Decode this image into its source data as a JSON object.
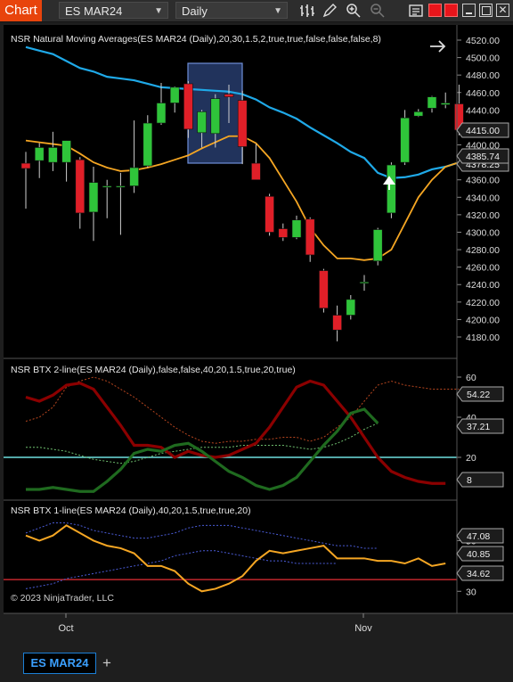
{
  "toolbar": {
    "chart_button": "Chart",
    "instrument": "ES MAR24",
    "interval": "Daily"
  },
  "panels": {
    "price": {
      "title": "NSR Natural Moving Averages(ES MAR24 (Daily),20,30,1.5,2,true,true,false,false,false,8)",
      "ticks": [
        "4520.00",
        "4500.00",
        "4480.00",
        "4460.00",
        "4440.00",
        "4420.00",
        "4400.00",
        "4380.00",
        "4360.00",
        "4340.00",
        "4320.00",
        "4300.00",
        "4280.00",
        "4260.00",
        "4240.00",
        "4220.00",
        "4200.00",
        "4180.00"
      ],
      "badge_last": "4415.00",
      "badge_ma": "4385.74",
      "badge_ma_hidden": "4378.25"
    },
    "btx2": {
      "title": "NSR BTX 2-line(ES MAR24 (Daily),false,false,40,20,1.5,true,20,true)",
      "ticks": [
        "60",
        "40",
        "20"
      ],
      "badge_a": "54.22",
      "badge_b": "37.21",
      "badge_c": "8"
    },
    "btx1": {
      "title": "NSR BTX 1-line(ES MAR24 (Daily),40,20,1.5,true,true,20)",
      "ticks": [
        "50",
        "30"
      ],
      "badge_a": "47.08",
      "badge_b": "40.85",
      "badge_c": "34.62"
    }
  },
  "copyright": "© 2023 NinjaTrader, LLC",
  "x_axis": {
    "labels": [
      "Oct",
      "Nov"
    ]
  },
  "tabs": [
    {
      "label": "ES MAR24"
    }
  ],
  "colors": {
    "bull": "#2fc43a",
    "bear": "#e01f28",
    "fast_ma": "#f5a623",
    "slow_ma": "#1fa9e8",
    "btx_red": "#8b0000",
    "btx_green": "#1f6a1f",
    "cyan_level": "#6fe0e0",
    "btx1_line": "#f5a623",
    "btx1_level": "#c1272d"
  },
  "chart_data": [
    {
      "type": "candlestick",
      "title": "NSR Natural Moving Averages(ES MAR24 (Daily),20,30,1.5,2,true,true,false,false,false,8)",
      "ylim": [
        4170,
        4530
      ],
      "xticks": [
        "Oct",
        "Nov"
      ],
      "candles": [
        {
          "o": 4379,
          "h": 4392,
          "l": 4327,
          "c": 4373
        },
        {
          "o": 4382,
          "h": 4402,
          "l": 4362,
          "c": 4397
        },
        {
          "o": 4380,
          "h": 4415,
          "l": 4370,
          "c": 4397
        },
        {
          "o": 4380,
          "h": 4405,
          "l": 4358,
          "c": 4405
        },
        {
          "o": 4383,
          "h": 4386,
          "l": 4304,
          "c": 4322
        },
        {
          "o": 4323,
          "h": 4375,
          "l": 4290,
          "c": 4357
        },
        {
          "o": 4352,
          "h": 4360,
          "l": 4316,
          "c": 4353
        },
        {
          "o": 4352,
          "h": 4368,
          "l": 4297,
          "c": 4353
        },
        {
          "o": 4353,
          "h": 4428,
          "l": 4345,
          "c": 4374
        },
        {
          "o": 4376,
          "h": 4434,
          "l": 4374,
          "c": 4425
        },
        {
          "o": 4425,
          "h": 4471,
          "l": 4423,
          "c": 4448
        },
        {
          "o": 4448,
          "h": 4467,
          "l": 4437,
          "c": 4466
        },
        {
          "o": 4470,
          "h": 4473,
          "l": 4408,
          "c": 4418
        },
        {
          "o": 4414,
          "h": 4440,
          "l": 4397,
          "c": 4438
        },
        {
          "o": 4413,
          "h": 4458,
          "l": 4397,
          "c": 4453
        },
        {
          "o": 4458,
          "h": 4469,
          "l": 4425,
          "c": 4455
        },
        {
          "o": 4451,
          "h": 4462,
          "l": 4378,
          "c": 4398
        },
        {
          "o": 4379,
          "h": 4401,
          "l": 4370,
          "c": 4360
        },
        {
          "o": 4341,
          "h": 4344,
          "l": 4296,
          "c": 4300
        },
        {
          "o": 4304,
          "h": 4310,
          "l": 4290,
          "c": 4294
        },
        {
          "o": 4294,
          "h": 4319,
          "l": 4292,
          "c": 4314
        },
        {
          "o": 4315,
          "h": 4317,
          "l": 4266,
          "c": 4274
        },
        {
          "o": 4256,
          "h": 4258,
          "l": 4208,
          "c": 4213
        },
        {
          "o": 4205,
          "h": 4216,
          "l": 4175,
          "c": 4188
        },
        {
          "o": 4205,
          "h": 4228,
          "l": 4200,
          "c": 4223
        },
        {
          "o": 4242,
          "h": 4251,
          "l": 4233,
          "c": 4243
        },
        {
          "o": 4267,
          "h": 4305,
          "l": 4262,
          "c": 4303
        },
        {
          "o": 4322,
          "h": 4380,
          "l": 4316,
          "c": 4377
        },
        {
          "o": 4380,
          "h": 4440,
          "l": 4377,
          "c": 4431
        },
        {
          "o": 4433,
          "h": 4441,
          "l": 4432,
          "c": 4438
        },
        {
          "o": 4442,
          "h": 4456,
          "l": 4437,
          "c": 4455
        },
        {
          "o": 4446,
          "h": 4460,
          "l": 4442,
          "c": 4448
        },
        {
          "o": 4447,
          "h": 4469,
          "l": 4411,
          "c": 4417
        }
      ],
      "fast_ma": [
        4405,
        4403,
        4401,
        4399,
        4390,
        4380,
        4374,
        4370,
        4371,
        4374,
        4378,
        4383,
        4388,
        4396,
        4403,
        4410,
        4410,
        4402,
        4385,
        4360,
        4335,
        4305,
        4285,
        4270,
        4270,
        4268,
        4270,
        4280,
        4310,
        4340,
        4360,
        4375,
        4380
      ],
      "slow_ma": [
        4512,
        4508,
        4504,
        4496,
        4488,
        4484,
        4478,
        4476,
        4474,
        4470,
        4466,
        4465,
        4464,
        4463,
        4462,
        4461,
        4458,
        4452,
        4443,
        4437,
        4430,
        4420,
        4411,
        4402,
        4392,
        4385,
        4368,
        4362,
        4363,
        4366,
        4372,
        4375,
        4380
      ]
    },
    {
      "type": "line",
      "title": "NSR BTX 2-line(ES MAR24 (Daily),false,false,40,20,1.5,true,20,true)",
      "ylim": [
        0,
        68
      ],
      "series": [
        {
          "values": [
            50,
            48,
            51,
            56,
            57,
            54,
            45,
            36,
            26,
            26,
            25,
            20,
            23,
            21,
            20,
            21,
            24,
            27,
            35,
            45,
            55,
            58,
            56,
            48,
            40,
            30,
            20,
            13,
            10,
            8,
            7,
            7
          ]
        },
        {
          "values": [
            4,
            4,
            5,
            4,
            3,
            3,
            8,
            14,
            22,
            24,
            23,
            26,
            27,
            23,
            18,
            13,
            10,
            6,
            4,
            6,
            10,
            18,
            26,
            33,
            42,
            44,
            37
          ]
        },
        {
          "values": [
            38,
            40,
            45,
            55,
            58,
            60,
            58,
            54,
            50,
            45,
            40,
            35,
            31,
            28,
            27,
            28,
            28,
            29,
            29,
            30,
            30,
            28,
            30,
            35,
            40,
            48,
            56,
            58,
            56,
            55,
            54,
            54,
            54
          ]
        },
        {
          "values": [
            25,
            25,
            24,
            23,
            21,
            19,
            18,
            17,
            18,
            20,
            22,
            23,
            24,
            25,
            25,
            25,
            26,
            26,
            26,
            26,
            25,
            24,
            25,
            27,
            30,
            34,
            37
          ]
        }
      ]
    },
    {
      "type": "line",
      "title": "NSR BTX 1-line(ES MAR24 (Daily),40,20,1.5,true,true,20)",
      "ylim": [
        22,
        60
      ],
      "series": [
        {
          "values": [
            52,
            50,
            52,
            56,
            53,
            50,
            48,
            47,
            45,
            40,
            40,
            38,
            33,
            30,
            31,
            33,
            36,
            42,
            46,
            45,
            46,
            47,
            48,
            43,
            43,
            43,
            42,
            42,
            41,
            43,
            40,
            41
          ]
        },
        {
          "values": [
            53,
            55,
            57,
            57,
            56,
            54,
            53,
            52,
            51,
            51,
            52,
            53,
            55,
            56,
            56,
            56,
            55,
            54,
            53,
            52,
            51,
            50,
            49,
            48,
            48,
            47,
            47
          ]
        },
        {
          "values": [
            31,
            32,
            33,
            35,
            36,
            37,
            38,
            39,
            40,
            41,
            42,
            44,
            45,
            46,
            46,
            45,
            44,
            43,
            42,
            42,
            41,
            41,
            41,
            41
          ]
        },
        {
          "values": [
            34.62
          ]
        }
      ]
    }
  ]
}
